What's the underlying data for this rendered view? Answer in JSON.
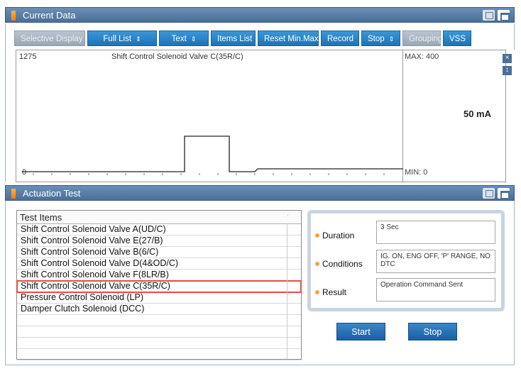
{
  "current_data": {
    "title": "Current Data",
    "toolbar": [
      {
        "label": "Selective Display",
        "dropdown": true,
        "enabled": false,
        "width": 100
      },
      {
        "label": "Full List",
        "dropdown": true,
        "enabled": true,
        "width": 98
      },
      {
        "label": "Text",
        "dropdown": true,
        "enabled": true,
        "width": 70
      },
      {
        "label": "Items List",
        "dropdown": true,
        "enabled": true,
        "width": 63
      },
      {
        "label": "Reset Min.Max",
        "dropdown": false,
        "enabled": true,
        "width": 86
      },
      {
        "label": "Record",
        "dropdown": false,
        "enabled": true,
        "width": 54
      },
      {
        "label": "Stop",
        "dropdown": true,
        "enabled": true,
        "width": 55
      },
      {
        "label": "Grouping",
        "dropdown": false,
        "enabled": false,
        "width": 54
      },
      {
        "label": "VSS",
        "dropdown": false,
        "enabled": true,
        "width": 40
      }
    ],
    "graph": {
      "max_value": "1275",
      "signal_name": "Shift Control Solenoid Valve C(35R/C)",
      "zero_label": "0",
      "range_max": "MAX: 400",
      "range_min": "MIN: 0",
      "reading": "50 mA"
    },
    "side_buttons": {
      "close": "×",
      "expand": "↕"
    }
  },
  "actuation_test": {
    "title": "Actuation Test",
    "items_header": "Test Items",
    "items": [
      "Shift Control Solenoid Valve A(UD/C)",
      "Shift Control Solenoid Valve E(27/B)",
      "Shift Control Solenoid Valve B(6/C)",
      "Shift Control Solenoid Valve D(4&OD/C)",
      "Shift Control Solenoid Valve F(8LR/B)",
      "Shift Control Solenoid Valve C(35R/C)",
      "Pressure Control Solenoid (LP)",
      "Damper Clutch Solenoid (DCC)",
      "",
      "",
      "",
      ""
    ],
    "selected_index": 5,
    "info": {
      "duration_label": "Duration",
      "duration_value": "3 Sec",
      "conditions_label": "Conditions",
      "conditions_value": "IG. ON, ENG OFF, 'P' RANGE, NO DTC",
      "result_label": "Result",
      "result_value": "Operation Command Sent"
    },
    "start_label": "Start",
    "stop_label": "Stop"
  },
  "colors": {
    "title_bar": "#4a6f98",
    "button_blue": "#1c73b8",
    "selection_outline": "#e84a4a",
    "signal_line": "#222222"
  }
}
